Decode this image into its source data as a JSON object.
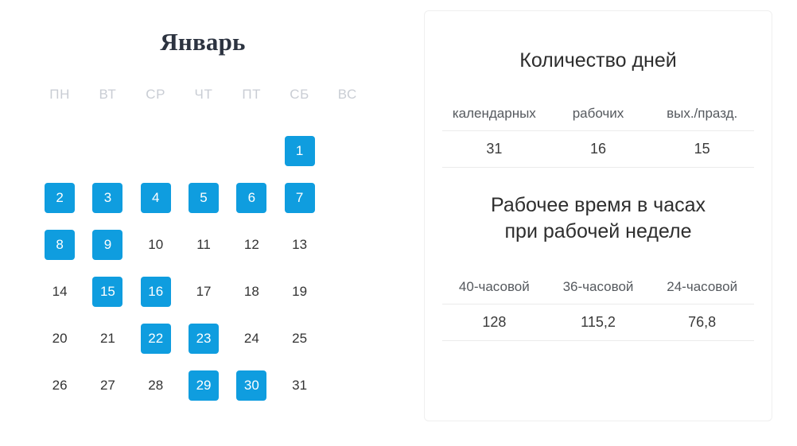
{
  "calendar": {
    "month_title": "Январь",
    "weekdays": [
      "ПН",
      "ВТ",
      "СР",
      "ЧТ",
      "ПТ",
      "СБ",
      "ВС"
    ],
    "leading_blanks": 5,
    "highlight_color": "#0f9ddf",
    "days": [
      {
        "n": "1",
        "highlighted": true
      },
      {
        "n": "2",
        "highlighted": true
      },
      {
        "n": "3",
        "highlighted": true
      },
      {
        "n": "4",
        "highlighted": true
      },
      {
        "n": "5",
        "highlighted": true
      },
      {
        "n": "6",
        "highlighted": true
      },
      {
        "n": "7",
        "highlighted": true
      },
      {
        "n": "8",
        "highlighted": true
      },
      {
        "n": "9",
        "highlighted": true
      },
      {
        "n": "10",
        "highlighted": false
      },
      {
        "n": "11",
        "highlighted": false
      },
      {
        "n": "12",
        "highlighted": false
      },
      {
        "n": "13",
        "highlighted": false
      },
      {
        "n": "14",
        "highlighted": false
      },
      {
        "n": "15",
        "highlighted": true
      },
      {
        "n": "16",
        "highlighted": true
      },
      {
        "n": "17",
        "highlighted": false
      },
      {
        "n": "18",
        "highlighted": false
      },
      {
        "n": "19",
        "highlighted": false
      },
      {
        "n": "20",
        "highlighted": false
      },
      {
        "n": "21",
        "highlighted": false
      },
      {
        "n": "22",
        "highlighted": true
      },
      {
        "n": "23",
        "highlighted": true
      },
      {
        "n": "24",
        "highlighted": false
      },
      {
        "n": "25",
        "highlighted": false
      },
      {
        "n": "26",
        "highlighted": false
      },
      {
        "n": "27",
        "highlighted": false
      },
      {
        "n": "28",
        "highlighted": false
      },
      {
        "n": "29",
        "highlighted": true
      },
      {
        "n": "30",
        "highlighted": true
      },
      {
        "n": "31",
        "highlighted": false
      }
    ]
  },
  "info_card": {
    "days_section": {
      "heading": "Количество дней",
      "headers": [
        "календарных",
        "рабочих",
        "вых./празд."
      ],
      "values": [
        "31",
        "16",
        "15"
      ]
    },
    "hours_section": {
      "heading_line1": "Рабочее время в часах",
      "heading_line2": "при рабочей неделе",
      "headers": [
        "40-часовой",
        "36-часовой",
        "24-часовой"
      ],
      "values": [
        "128",
        "115,2",
        "76,8"
      ]
    }
  }
}
